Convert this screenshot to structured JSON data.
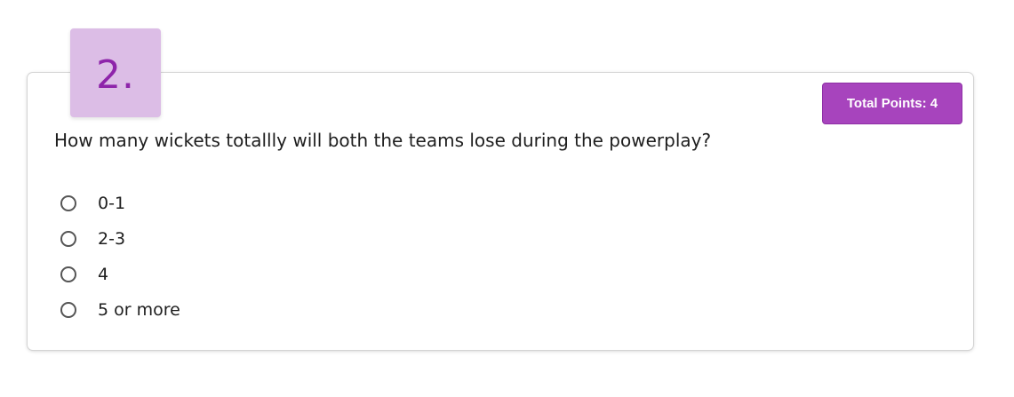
{
  "question": {
    "number": "2.",
    "text": "How many wickets totallly will both the teams lose during the powerplay?",
    "points_label": "Total Points: 4",
    "options": [
      {
        "label": "0-1",
        "selected": false
      },
      {
        "label": "2-3",
        "selected": false
      },
      {
        "label": "4",
        "selected": false
      },
      {
        "label": "5 or more",
        "selected": false
      }
    ]
  },
  "colors": {
    "accent": "#a744bd",
    "badge_bg": "#dcbde6",
    "badge_text": "#8e24aa"
  }
}
